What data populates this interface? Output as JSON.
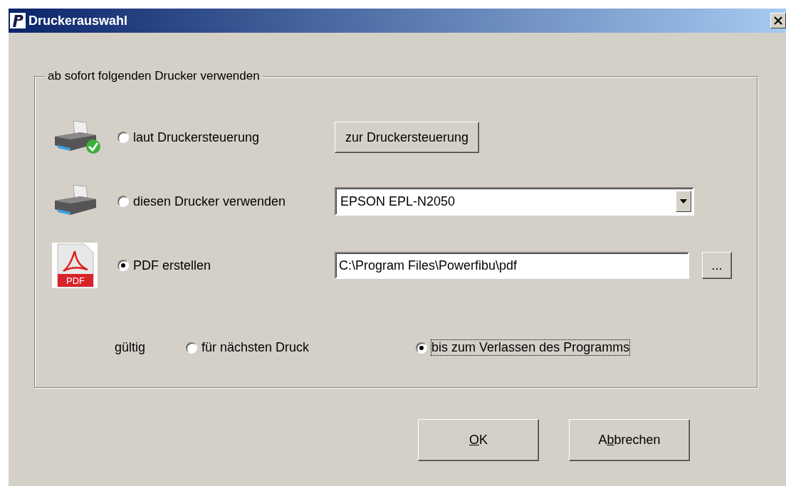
{
  "window": {
    "title": "Druckerauswahl"
  },
  "group": {
    "legend": "ab sofort folgenden Drucker verwenden",
    "options": [
      {
        "kind": "button",
        "label": "laut Druckersteuerung",
        "selected": false,
        "button": "zur Druckersteuerung"
      },
      {
        "kind": "dropdown",
        "label": "diesen Drucker verwenden",
        "selected": false,
        "value": "EPSON EPL-N2050"
      },
      {
        "kind": "path",
        "icon_text": "PDF",
        "label": "PDF erstellen",
        "selected": true,
        "value": "C:\\Program Files\\Powerfibu\\pdf",
        "browse_button": "..."
      }
    ],
    "validity": {
      "label": "gültig",
      "options": [
        {
          "label": "für nächsten Druck",
          "selected": false,
          "focused": false
        },
        {
          "label": "bis zum Verlassen des Programms",
          "selected": true,
          "focused": true
        }
      ]
    }
  },
  "buttons": [
    {
      "mnemonic": "O",
      "after": "K"
    },
    {
      "before": "A",
      "mnemonic": "b",
      "after": "brechen"
    }
  ]
}
